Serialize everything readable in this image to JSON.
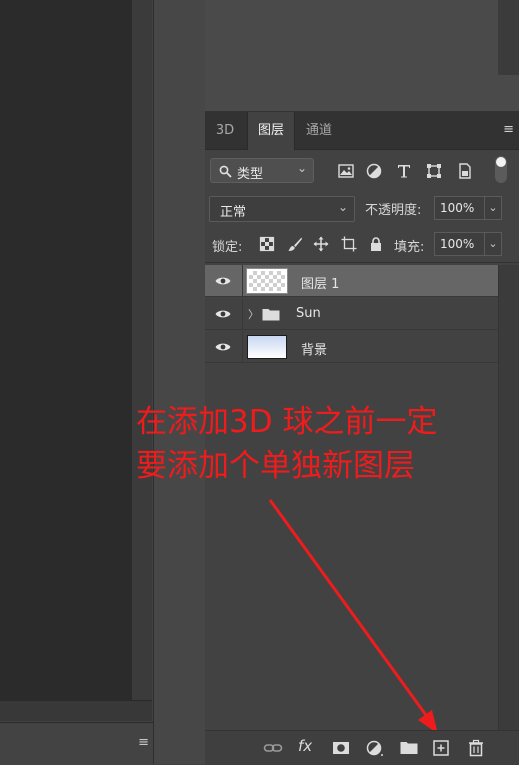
{
  "left_panel": {
    "menu_icon": "hamburger-menu-icon"
  },
  "tabs": [
    {
      "label": "3D",
      "active": false
    },
    {
      "label": "图层",
      "active": true
    },
    {
      "label": "通道",
      "active": false
    }
  ],
  "filter": {
    "kind_label": "类型",
    "icons": [
      "image-filter-icon",
      "adjustment-filter-icon",
      "type-filter-icon",
      "shape-filter-icon",
      "smart-object-filter-icon"
    ]
  },
  "blend": {
    "mode": "正常",
    "opacity_label": "不透明度:",
    "opacity_value": "100%"
  },
  "lock": {
    "label": "锁定:",
    "fill_label": "填充:",
    "fill_value": "100%",
    "icons": [
      "lock-transparent-pixels-icon",
      "lock-image-pixels-icon",
      "lock-position-icon",
      "lock-artboard-icon",
      "lock-all-icon"
    ]
  },
  "layers": [
    {
      "name": "图层 1",
      "type": "pixel",
      "selected": true,
      "visible": true
    },
    {
      "name": "Sun",
      "type": "group",
      "selected": false,
      "visible": true
    },
    {
      "name": "背景",
      "type": "background",
      "selected": false,
      "visible": true
    }
  ],
  "annotation": {
    "line1": "在添加3D 球之前一定",
    "line2": "要添加个单独新图层",
    "color": "#ee1c1c"
  },
  "footer": {
    "buttons": [
      "link-layers-icon",
      "fx-icon",
      "add-mask-icon",
      "adjustment-layer-icon",
      "new-group-icon",
      "new-layer-icon",
      "delete-layer-icon"
    ],
    "fx_label": "fx"
  },
  "colors": {
    "panel_bg": "#424242",
    "selected_row": "#666666",
    "tab_bar": "#323232",
    "annotation_red": "#ee1c1c"
  }
}
